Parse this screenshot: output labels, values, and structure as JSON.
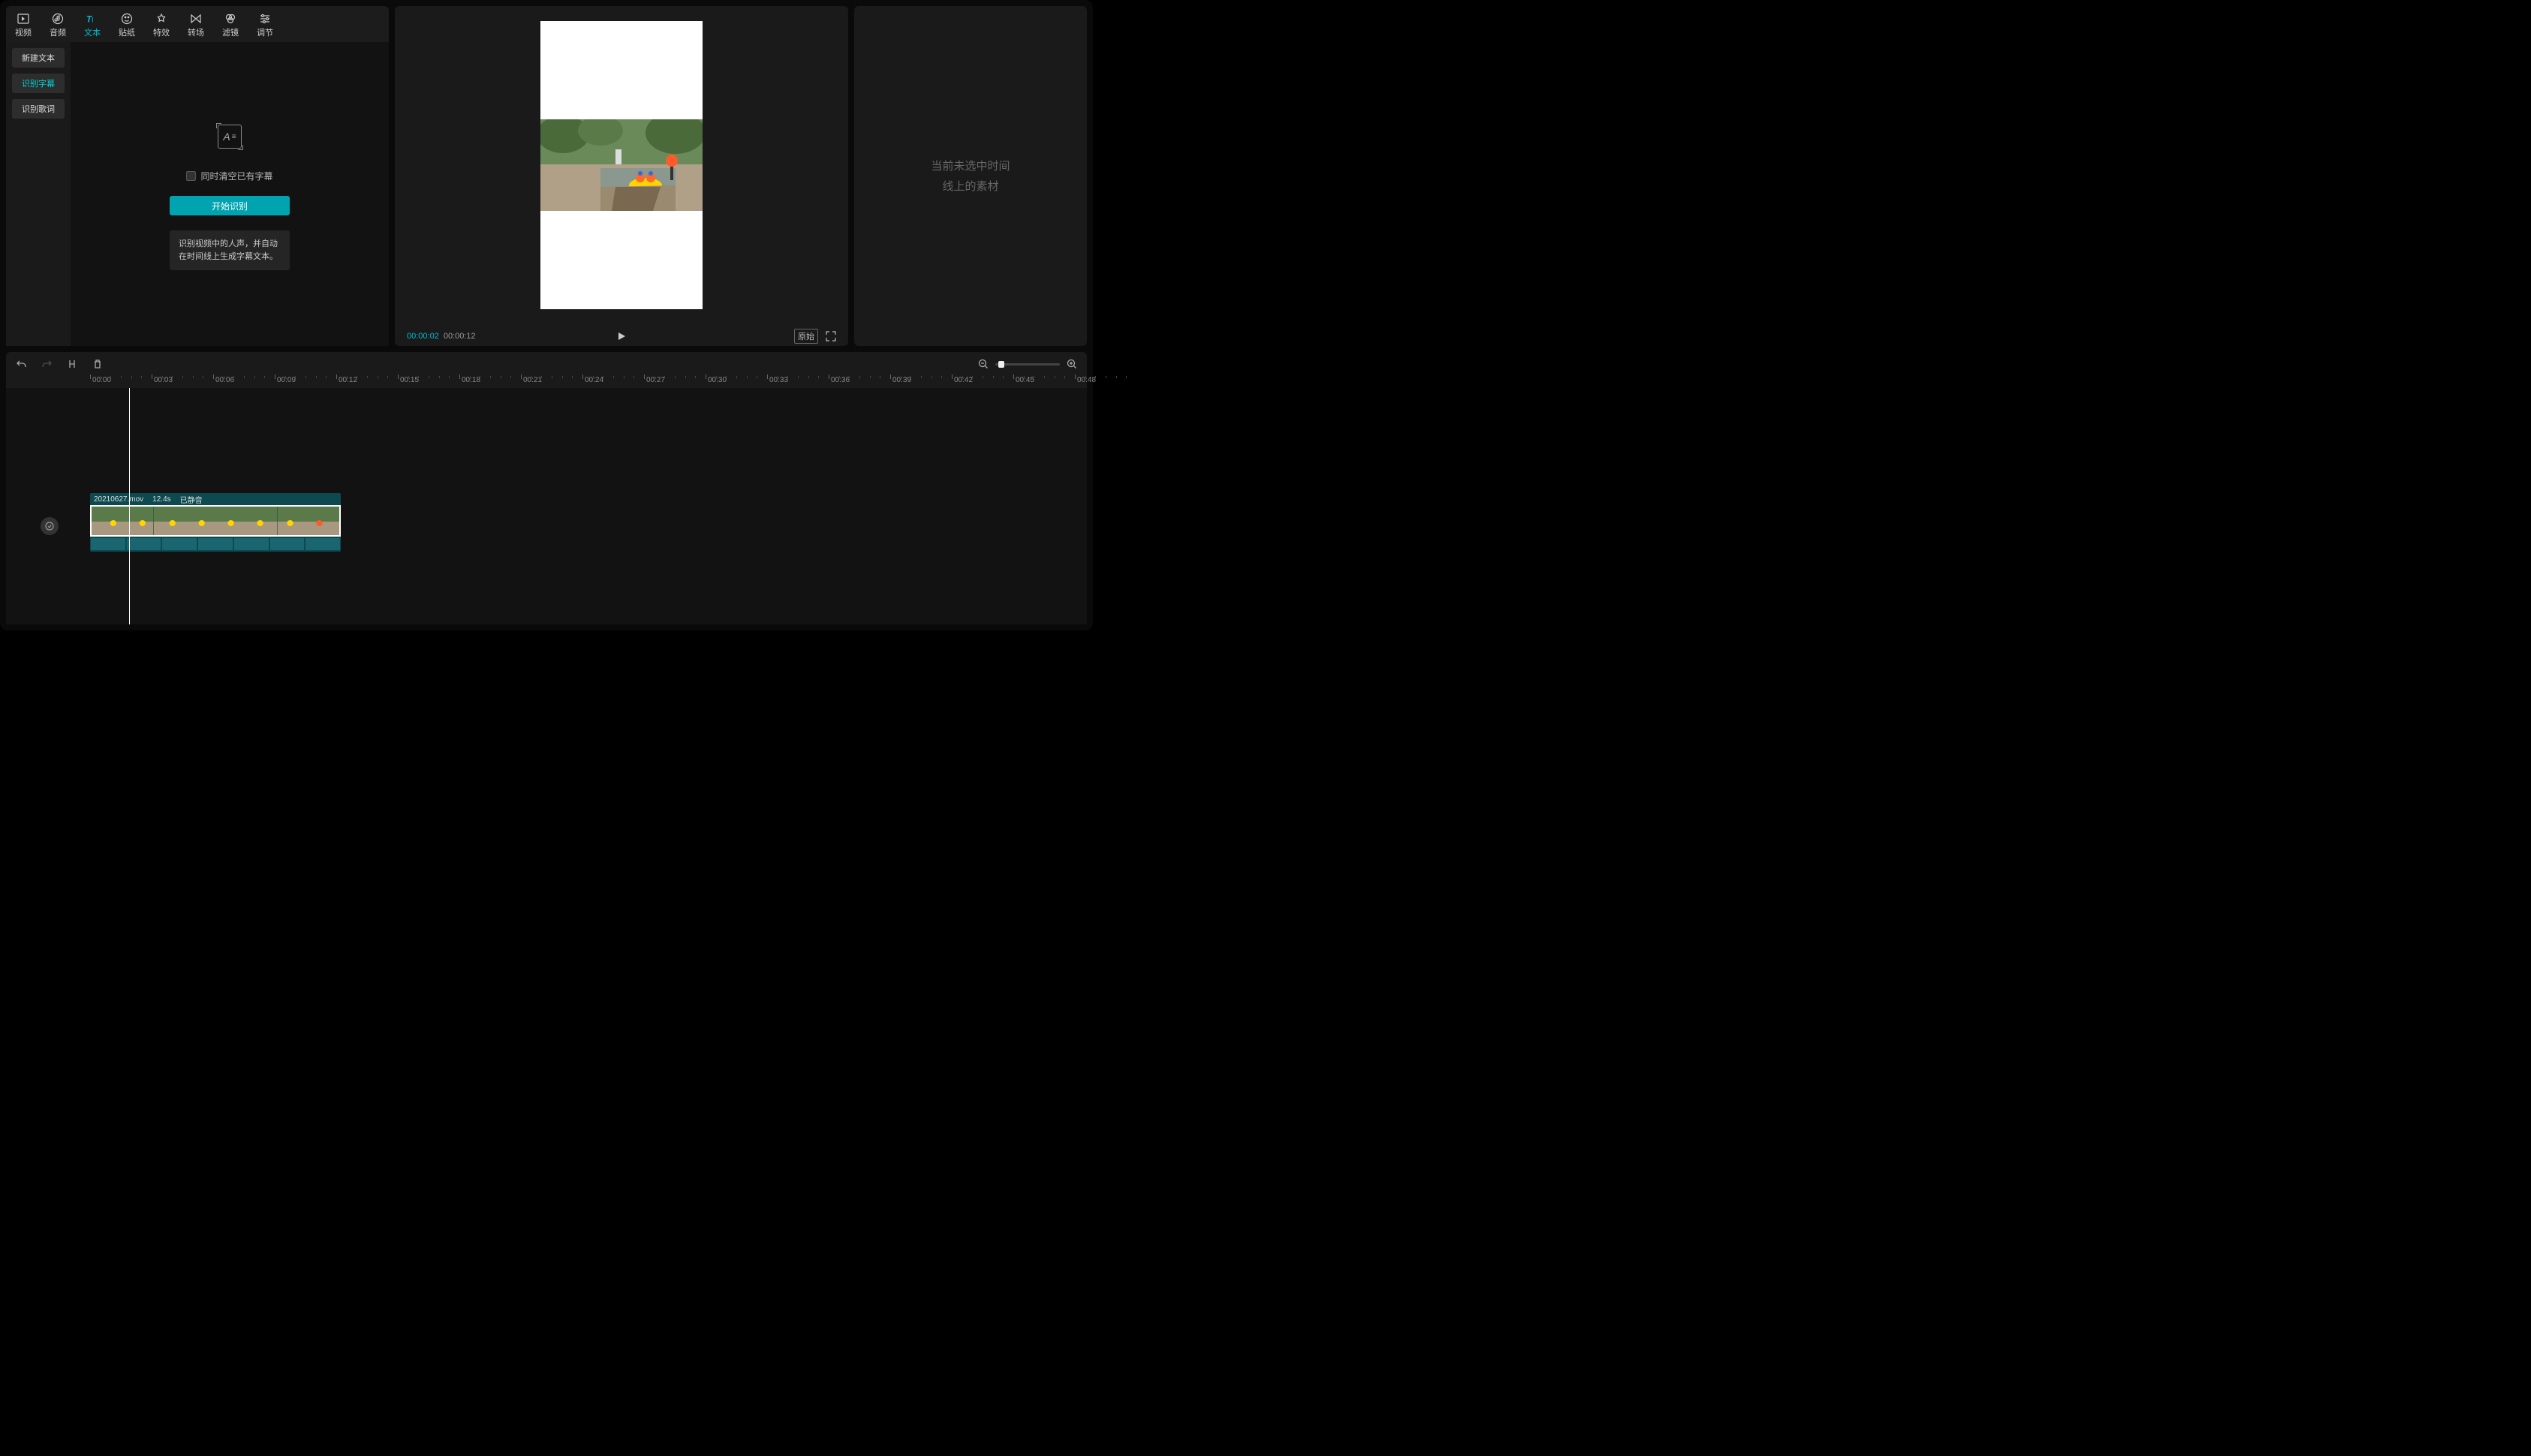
{
  "topTabs": [
    {
      "id": "video",
      "label": "视频"
    },
    {
      "id": "audio",
      "label": "音频"
    },
    {
      "id": "text",
      "label": "文本"
    },
    {
      "id": "sticker",
      "label": "贴纸"
    },
    {
      "id": "effect",
      "label": "特效"
    },
    {
      "id": "transition",
      "label": "转场"
    },
    {
      "id": "filter",
      "label": "滤镜"
    },
    {
      "id": "adjust",
      "label": "调节"
    }
  ],
  "activeTopTab": "text",
  "sideTabs": [
    {
      "id": "new-text",
      "label": "新建文本"
    },
    {
      "id": "recognize-subtitle",
      "label": "识别字幕"
    },
    {
      "id": "recognize-lyrics",
      "label": "识别歌词"
    }
  ],
  "activeSideTab": "recognize-subtitle",
  "subtitlePanel": {
    "clearExistingLabel": "同时清空已有字幕",
    "startButton": "开始识别",
    "hintText": "识别视频中的人声，并自动在时间线上生成字幕文本。"
  },
  "preview": {
    "currentTime": "00:00:02",
    "totalTime": "00:00:12",
    "originalButton": "原始"
  },
  "rightPlaceholder": {
    "line1": "当前未选中时间",
    "line2": "线上的素材"
  },
  "timeline": {
    "ticks": [
      "00:00",
      "00:03",
      "00:06",
      "00:09",
      "00:12",
      "00:15",
      "00:18",
      "00:21",
      "00:24",
      "00:27",
      "00:30",
      "00:33",
      "00:36",
      "00:39",
      "00:42",
      "00:45",
      "00:48"
    ],
    "clip": {
      "filename": "20210627.mov",
      "duration": "12.4s",
      "muted": "已静音"
    }
  }
}
